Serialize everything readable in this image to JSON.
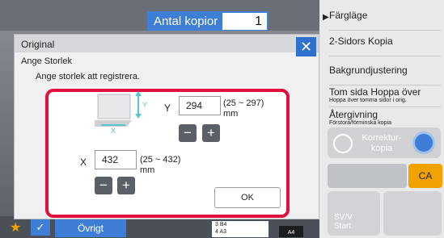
{
  "header": {
    "copies_label": "Antal kopior",
    "copies_value": "1"
  },
  "right_panel": {
    "items": [
      {
        "label": "Färgläge",
        "sub": ""
      },
      {
        "label": "2-Sidors Kopia",
        "sub": ""
      },
      {
        "label": "Bakgrundjustering",
        "sub": ""
      },
      {
        "label": "Tom sida Hoppa över",
        "sub": "Hoppa över tomma sidor i orig."
      },
      {
        "label": "Återgivning",
        "sub": "Förstora/förminska kopia"
      }
    ],
    "korrektur_label": "Korrektur-\nkopia",
    "ca_label": "CA",
    "start_label": "SV/V\nStart"
  },
  "dialog": {
    "title": "Original",
    "section": "Ange Storlek",
    "instruction": "Ange storlek att registrera.",
    "y": {
      "label": "Y",
      "value": "294",
      "range": "(25 ~ 297)\nmm"
    },
    "x": {
      "label": "X",
      "value": "432",
      "range": "(25 ~ 432)\nmm"
    },
    "minus": "−",
    "plus": "+",
    "ok_label": "OK",
    "close_icon": "close-icon"
  },
  "bottom": {
    "ovrigt_label": "Övrigt",
    "trays": [
      "3  B4",
      "4  A3"
    ],
    "paper_badge": "A4"
  }
}
